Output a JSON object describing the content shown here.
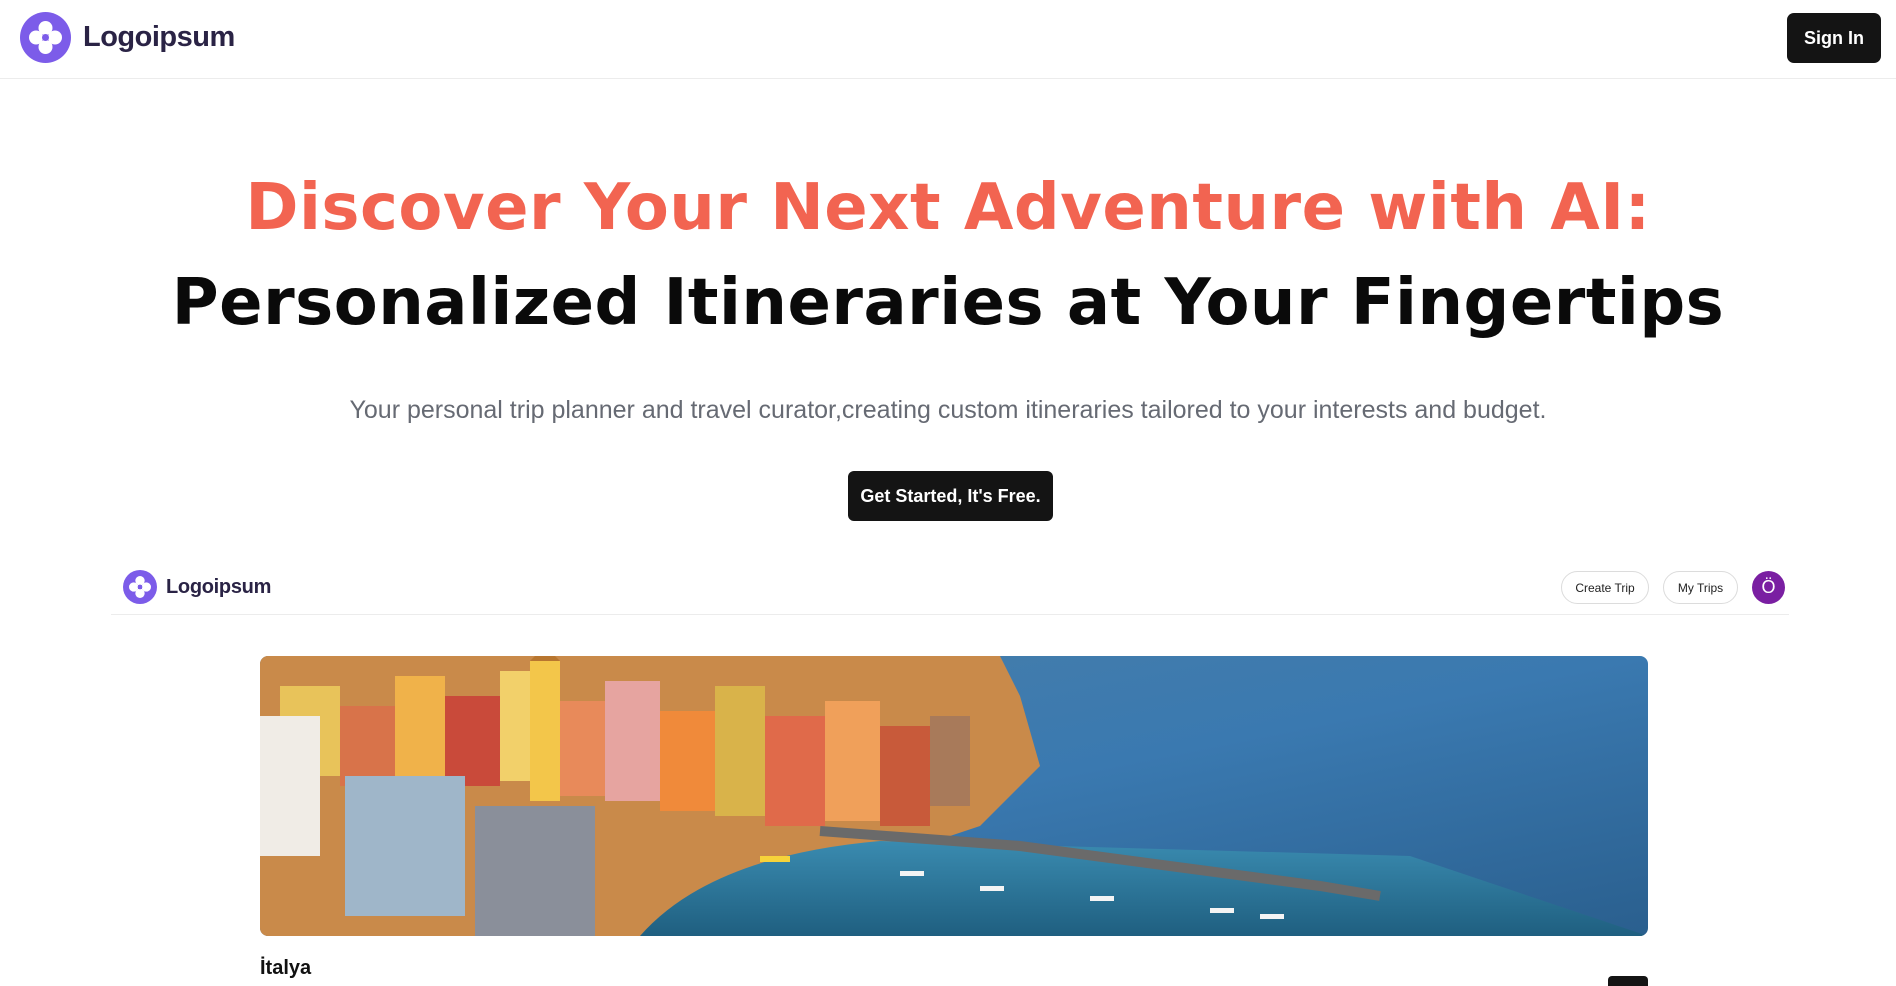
{
  "header": {
    "brand_name": "Logoipsum",
    "signin_label": "Sign In"
  },
  "hero": {
    "title_line1": "Discover Your Next Adventure with AI:",
    "title_line2": "Personalized Itineraries at Your Fingertips",
    "subtitle": "Your personal trip planner and travel curator,creating custom itineraries tailored to your interests and budget.",
    "cta_label": "Get Started, It's Free."
  },
  "preview": {
    "brand_name": "Logoipsum",
    "create_trip_label": "Create Trip",
    "my_trips_label": "My Trips",
    "avatar_initial": "Ö",
    "image_icon": "coastal-town-photo",
    "destination_title": "İtalya"
  },
  "colors": {
    "accent": "#f26451",
    "brand_purple": "#7c5ce9",
    "dark_button": "#141414",
    "avatar": "#7a1fa2"
  }
}
